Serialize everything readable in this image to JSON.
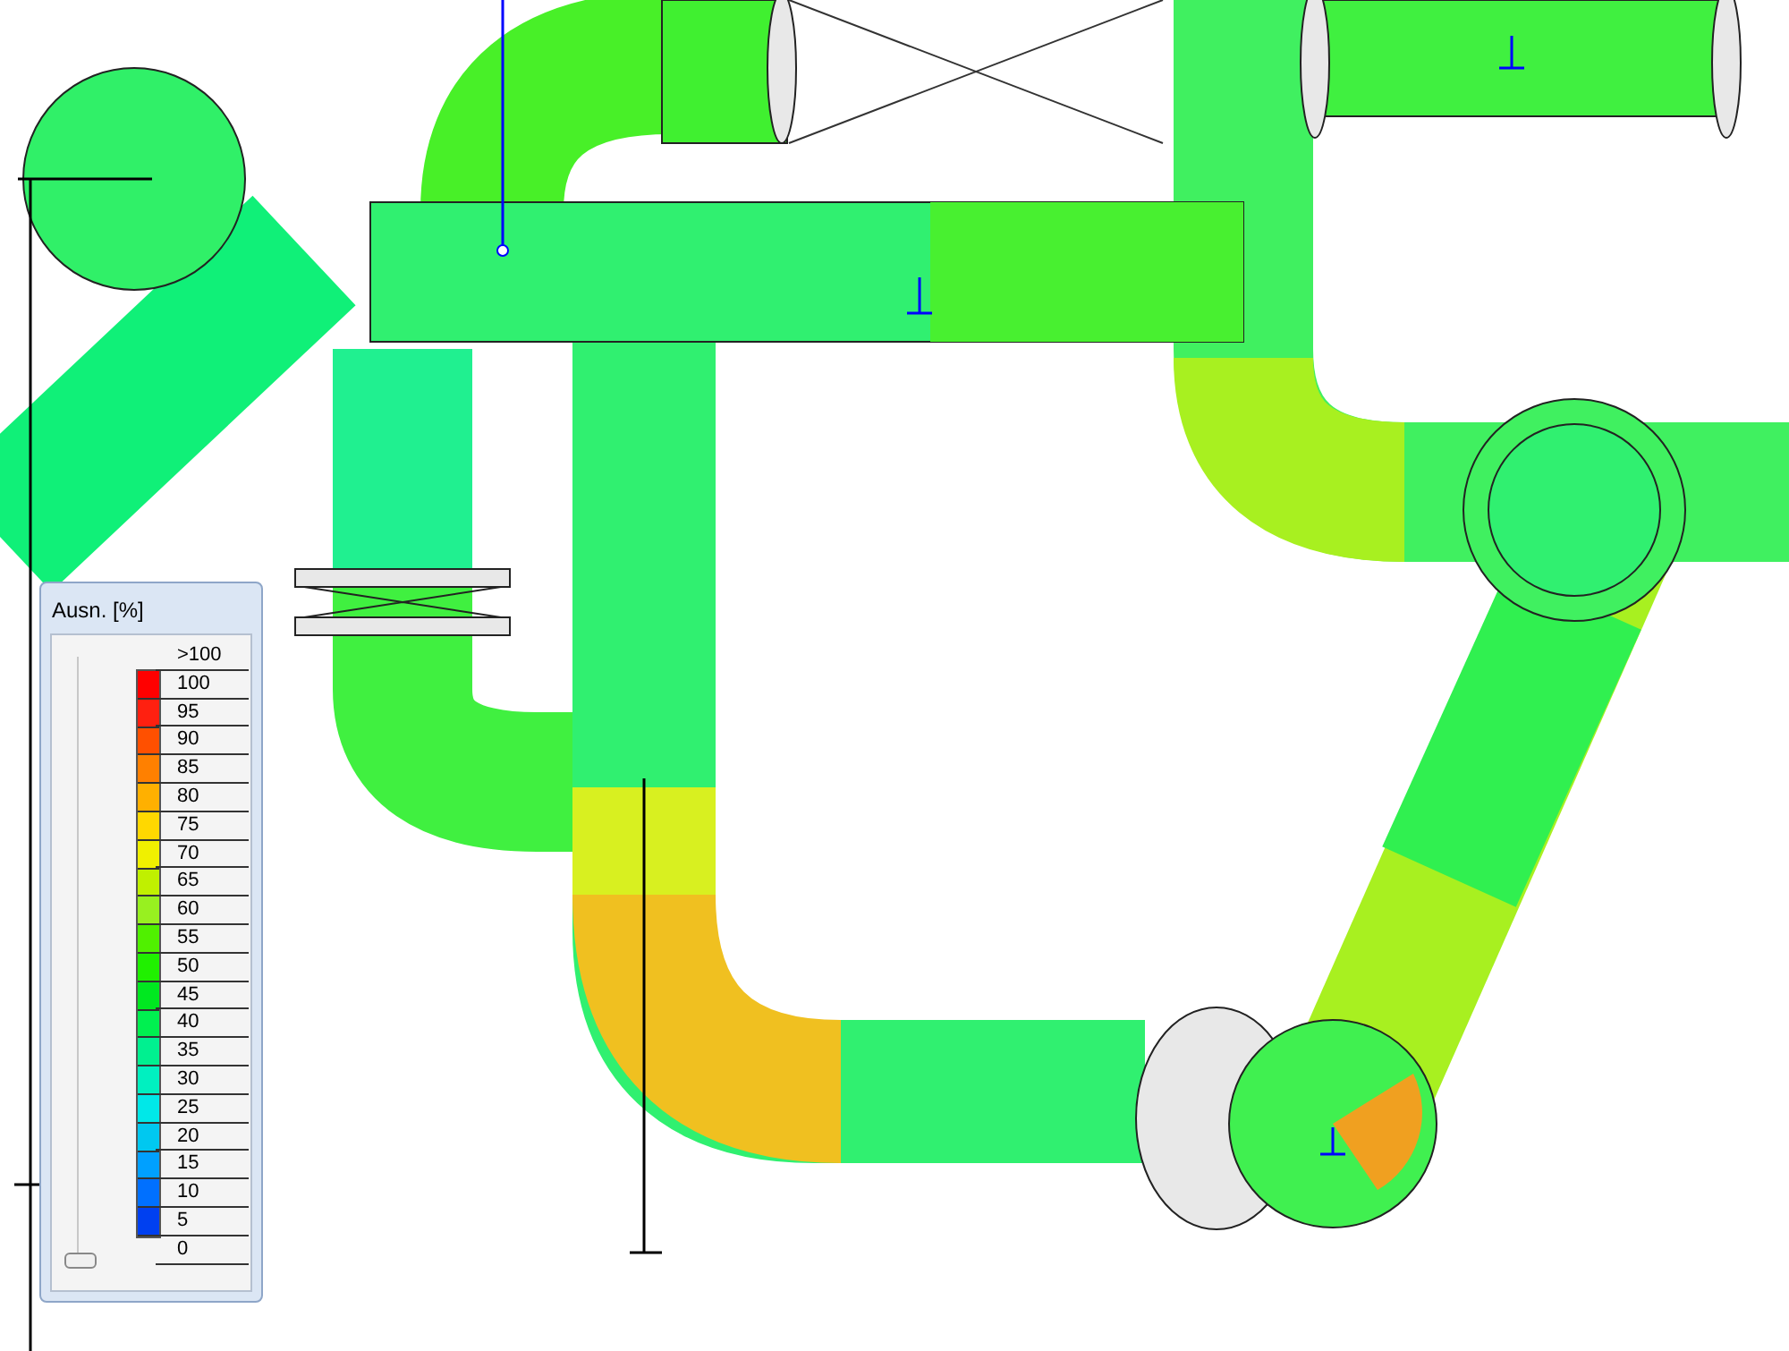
{
  "legend": {
    "title": "Ausn. [%]",
    "labels": [
      ">100",
      "100",
      "95",
      "90",
      "85",
      "80",
      "75",
      "70",
      "65",
      "60",
      "55",
      "50",
      "45",
      "40",
      "35",
      "30",
      "25",
      "20",
      "15",
      "10",
      "5",
      "0"
    ],
    "bands": [
      {
        "color": "#ff0000"
      },
      {
        "color": "#ff2010"
      },
      {
        "color": "#ff5000"
      },
      {
        "color": "#ff8000"
      },
      {
        "color": "#ffb000"
      },
      {
        "color": "#ffd800"
      },
      {
        "color": "#f0f000"
      },
      {
        "color": "#c0f000"
      },
      {
        "color": "#98f020"
      },
      {
        "color": "#50f000"
      },
      {
        "color": "#20f000"
      },
      {
        "color": "#00e820"
      },
      {
        "color": "#00f050"
      },
      {
        "color": "#00f090"
      },
      {
        "color": "#00f0c0"
      },
      {
        "color": "#00e8e8"
      },
      {
        "color": "#00c8f0"
      },
      {
        "color": "#00a0ff"
      },
      {
        "color": "#0070ff"
      },
      {
        "color": "#0040f0"
      }
    ],
    "slider": {
      "level": 0
    }
  }
}
